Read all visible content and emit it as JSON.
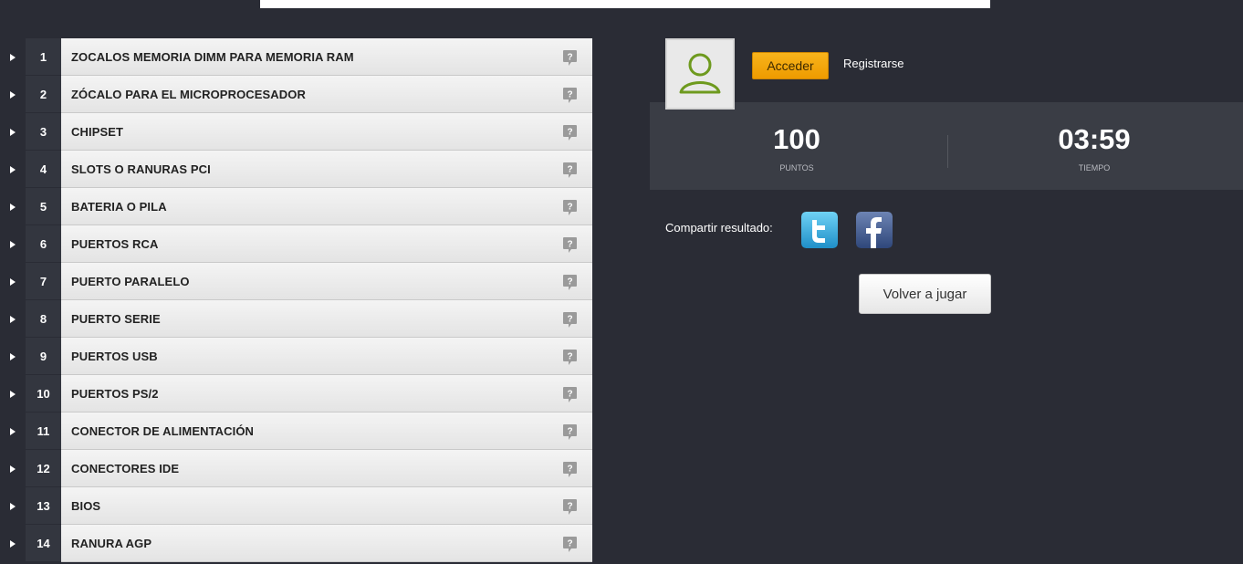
{
  "answers": [
    {
      "number": "1",
      "label": "ZOCALOS MEMORIA DIMM PARA MEMORIA RAM"
    },
    {
      "number": "2",
      "label": "ZÓCALO PARA EL MICROPROCESADOR"
    },
    {
      "number": "3",
      "label": "CHIPSET"
    },
    {
      "number": "4",
      "label": "SLOTS O RANURAS PCI"
    },
    {
      "number": "5",
      "label": "BATERIA O PILA"
    },
    {
      "number": "6",
      "label": "PUERTOS RCA"
    },
    {
      "number": "7",
      "label": "PUERTO PARALELO"
    },
    {
      "number": "8",
      "label": "PUERTO SERIE"
    },
    {
      "number": "9",
      "label": "PUERTOS USB"
    },
    {
      "number": "10",
      "label": "PUERTOS PS/2"
    },
    {
      "number": "11",
      "label": "CONECTOR DE ALIMENTACIÓN"
    },
    {
      "number": "12",
      "label": "CONECTORES IDE"
    },
    {
      "number": "13",
      "label": "BIOS"
    },
    {
      "number": "14",
      "label": "RANURA AGP"
    }
  ],
  "account": {
    "login_label": "Acceder",
    "register_label": "Registrarse"
  },
  "score": {
    "points_value": "100",
    "points_label": "PUNTOS",
    "time_value": "03:59",
    "time_label": "TIEMPO"
  },
  "share": {
    "label": "Compartir resultado:"
  },
  "replay": {
    "label": "Volver a jugar"
  },
  "colors": {
    "background": "#2a2c35",
    "score_band": "#3a3d45",
    "accent_orange": "#f0a30a",
    "avatar_green": "#6e9a1e",
    "twitter_blue": "#33a9dd",
    "facebook_blue": "#3b5998"
  },
  "icons": {
    "row_arrow": "triangle-right-icon",
    "hint": "speech-bubble-question-icon",
    "avatar": "user-silhouette-icon",
    "twitter": "twitter-bird-icon",
    "facebook": "facebook-f-icon"
  }
}
